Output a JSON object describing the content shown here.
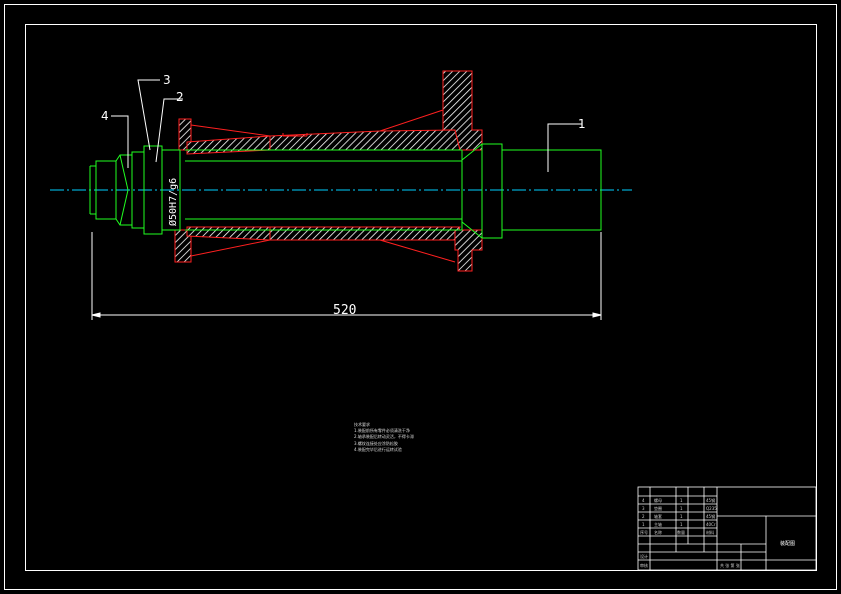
{
  "balloons": {
    "b1": "1",
    "b2": "2",
    "b3": "3",
    "b4": "4"
  },
  "dimension": {
    "overall_length": "520",
    "fit_note": "Ø50H7/g6"
  },
  "technical_notes": {
    "heading": "技术要求",
    "lines": [
      "1.装配前所有零件必须清洗干净",
      "2.轴承装配后转动灵活，不得卡滞",
      "3.螺纹连接处应涂防松胶",
      "4.装配完毕后进行运转试验"
    ]
  },
  "title_block": {
    "drawing_name": "装配图",
    "parts_rows": [
      {
        "no": "4",
        "name": "螺母",
        "qty": "1",
        "material": "45钢"
      },
      {
        "no": "3",
        "name": "垫圈",
        "qty": "1",
        "material": "Q235"
      },
      {
        "no": "2",
        "name": "轴套",
        "qty": "1",
        "material": "45钢"
      },
      {
        "no": "1",
        "name": "主轴",
        "qty": "1",
        "material": "40Cr"
      }
    ],
    "header": {
      "no": "序号",
      "name": "名称",
      "qty": "数量",
      "material": "材料"
    },
    "design_label": "设计",
    "check_label": "审核",
    "sheet_text": "共 张 第 张"
  }
}
